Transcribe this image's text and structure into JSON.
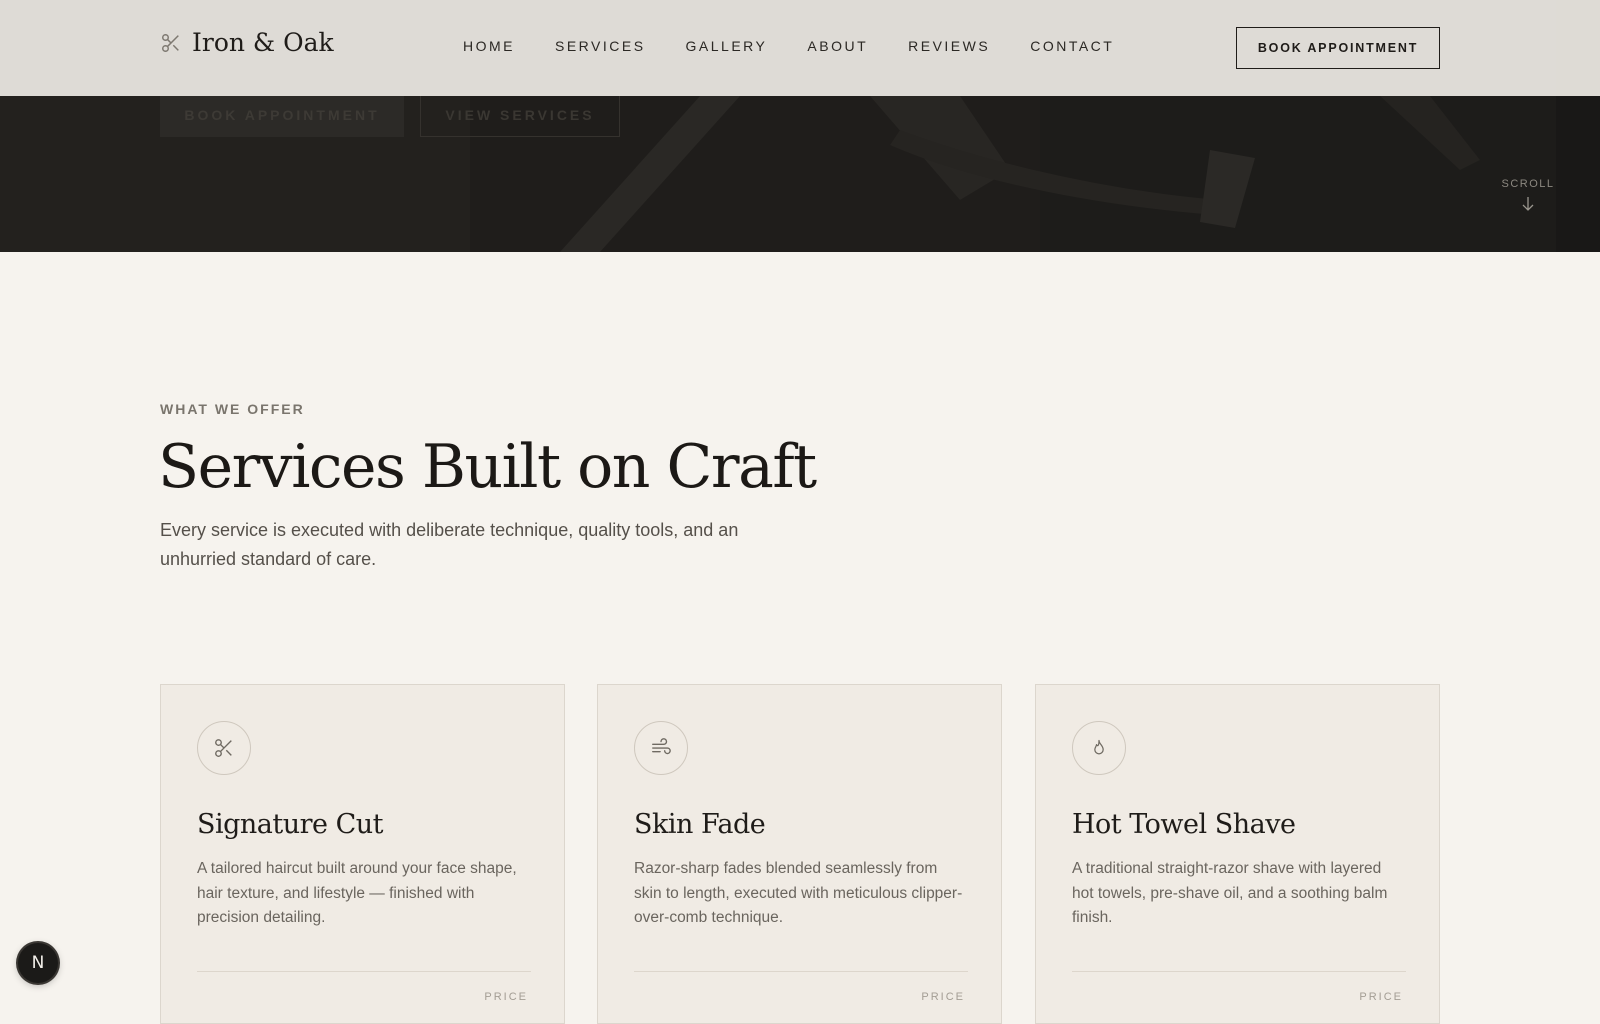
{
  "brand": {
    "name": "Iron & Oak",
    "icon": "scissors-icon"
  },
  "nav": {
    "items": [
      "HOME",
      "SERVICES",
      "GALLERY",
      "ABOUT",
      "REVIEWS",
      "CONTACT"
    ],
    "cta_label": "BOOK APPOINTMENT"
  },
  "hero": {
    "primary_button": "BOOK APPOINTMENT",
    "secondary_button": "VIEW SERVICES",
    "scroll_label": "SCROLL",
    "scroll_icon": "arrow-down-icon"
  },
  "services": {
    "eyebrow": "WHAT WE OFFER",
    "title": "Services Built on Craft",
    "description": "Every service is executed with deliberate technique, quality tools, and an unhurried standard of care.",
    "cards": [
      {
        "icon": "scissors-icon",
        "title": "Signature Cut",
        "description": "A tailored haircut built around your face shape, hair texture, and lifestyle — finished with precision detailing.",
        "price_label": "PRICE"
      },
      {
        "icon": "wind-icon",
        "title": "Skin Fade",
        "description": "Razor-sharp fades blended seamlessly from skin to length, executed with meticulous clipper-over-comb technique.",
        "price_label": "PRICE"
      },
      {
        "icon": "flame-icon",
        "title": "Hot Towel Shave",
        "description": "A traditional straight-razor shave with layered hot towels, pre-shave oil, and a soothing balm finish.",
        "price_label": "PRICE"
      }
    ]
  },
  "floating_badge": {
    "label": "N",
    "icon": "n-logo-icon"
  },
  "colors": {
    "background": "#f6f3ee",
    "hero_dark": "#1e1c1a",
    "header_bg": "#e6e3de",
    "card_bg": "#f0ebe4",
    "text_primary": "#1f1c19",
    "text_muted": "#6a655e"
  }
}
